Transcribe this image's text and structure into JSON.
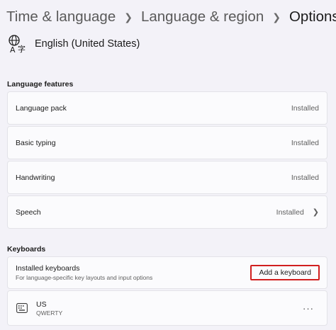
{
  "breadcrumb": {
    "level1": "Time & language",
    "level2": "Language & region",
    "current": "Options"
  },
  "language": {
    "icon": "language-icon",
    "name": "English (United States)"
  },
  "features": {
    "title": "Language features",
    "items": [
      {
        "label": "Language pack",
        "status": "Installed"
      },
      {
        "label": "Basic typing",
        "status": "Installed"
      },
      {
        "label": "Handwriting",
        "status": "Installed"
      },
      {
        "label": "Speech",
        "status": "Installed"
      }
    ]
  },
  "keyboards": {
    "title": "Keyboards",
    "installed_title": "Installed keyboards",
    "installed_subtitle": "For language-specific key layouts and input options",
    "add_button": "Add a keyboard",
    "items": [
      {
        "name": "US",
        "layout": "QWERTY",
        "more": "···"
      }
    ]
  },
  "colors": {
    "background": "#f3f2f8",
    "card": "#fbfbfd",
    "highlight": "#d11f1f"
  }
}
